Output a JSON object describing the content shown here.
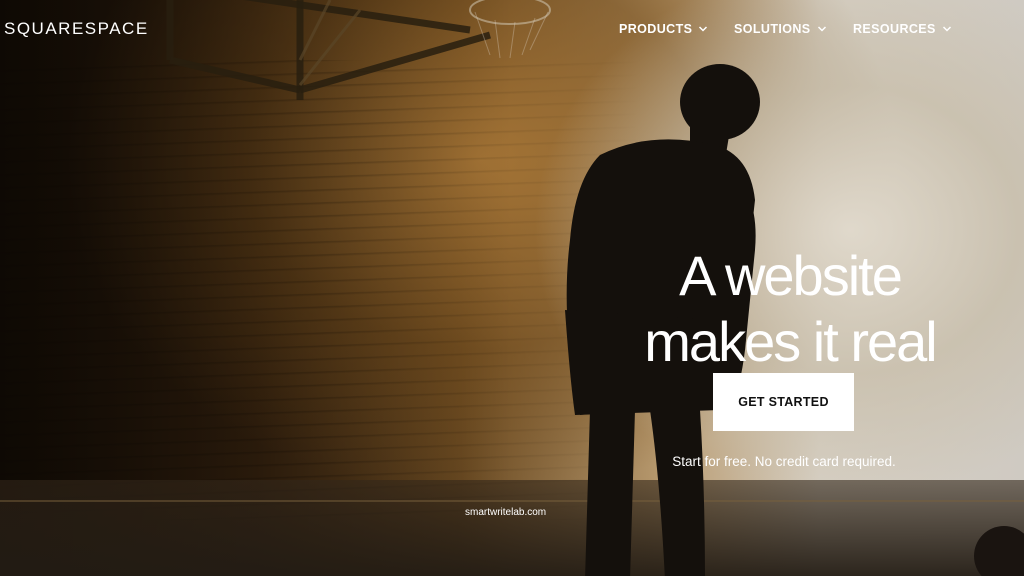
{
  "brand": {
    "logo_text": "SQUARESPACE"
  },
  "nav": {
    "items": [
      {
        "label": "PRODUCTS",
        "icon": "chevron-down-icon"
      },
      {
        "label": "SOLUTIONS",
        "icon": "chevron-down-icon"
      },
      {
        "label": "RESOURCES",
        "icon": "chevron-down-icon"
      }
    ]
  },
  "hero": {
    "headline_line1": "A website",
    "headline_line2": "makes it real",
    "cta_label": "GET STARTED",
    "subtext": "Start for free. No credit card required.",
    "watermark": "smartwritelab.com"
  },
  "colors": {
    "text": "#ffffff",
    "cta_background": "#ffffff",
    "cta_text": "#111111"
  }
}
